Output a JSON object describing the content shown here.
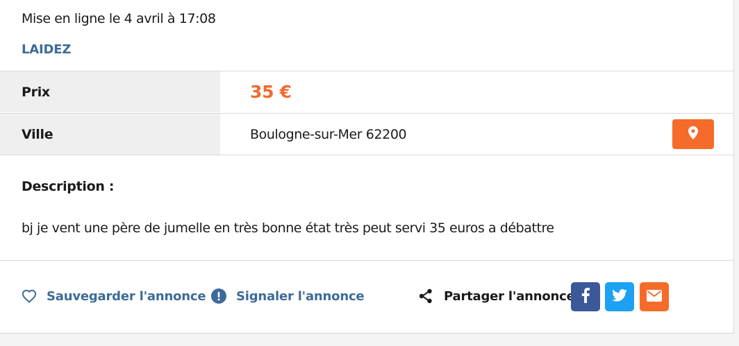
{
  "listing": {
    "posted_text": "Mise en ligne le 4 avril à 17:08",
    "seller_name": "LAIDEZ"
  },
  "details": {
    "price_label": "Prix",
    "price_value": "35 €",
    "city_label": "Ville",
    "city_value": "Boulogne-sur-Mer 62200",
    "map_icon": "map-pin-icon"
  },
  "description": {
    "title": "Description :",
    "text": "bj je vent une père de jumelle en très bonne état très peut servi 35 euros a débattre"
  },
  "actions": {
    "save_label": "Sauvegarder l'annonce",
    "save_icon": "heart-icon",
    "report_label": "Signaler l'annonce",
    "report_icon": "exclamation-circle-icon",
    "share_label": "Partager l'annonce",
    "share_icon": "share-icon"
  },
  "social": {
    "facebook_icon": "facebook-icon",
    "twitter_icon": "twitter-icon",
    "email_icon": "email-icon"
  },
  "colors": {
    "accent_orange": "#f56b2a",
    "price_orange": "#f26a2e",
    "link_blue": "#3d6b99",
    "facebook_blue": "#3b5998",
    "twitter_blue": "#1da1f2",
    "email_orange": "#f56b2a",
    "label_background": "#efefef"
  }
}
